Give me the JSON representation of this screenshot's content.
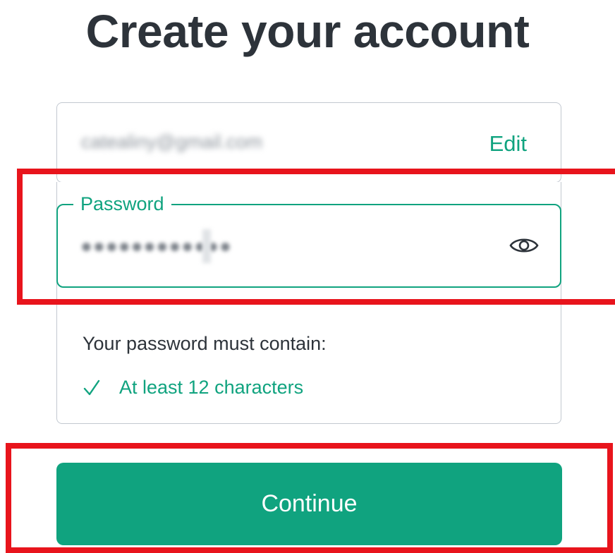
{
  "page": {
    "title": "Create your account"
  },
  "email": {
    "value": "catealiny@gmail.com",
    "edit_label": "Edit"
  },
  "password": {
    "label": "Password",
    "value": "●●●●●●●●●●●●",
    "toggle_icon": "eye-icon"
  },
  "requirements": {
    "title": "Your password must contain:",
    "items": [
      {
        "icon": "check-icon",
        "label": "At least 12 characters",
        "met": true
      }
    ]
  },
  "actions": {
    "continue_label": "Continue"
  },
  "colors": {
    "accent": "#10a37f",
    "text": "#2d333a",
    "border": "#c2c8d0",
    "highlight": "#e8141c"
  }
}
